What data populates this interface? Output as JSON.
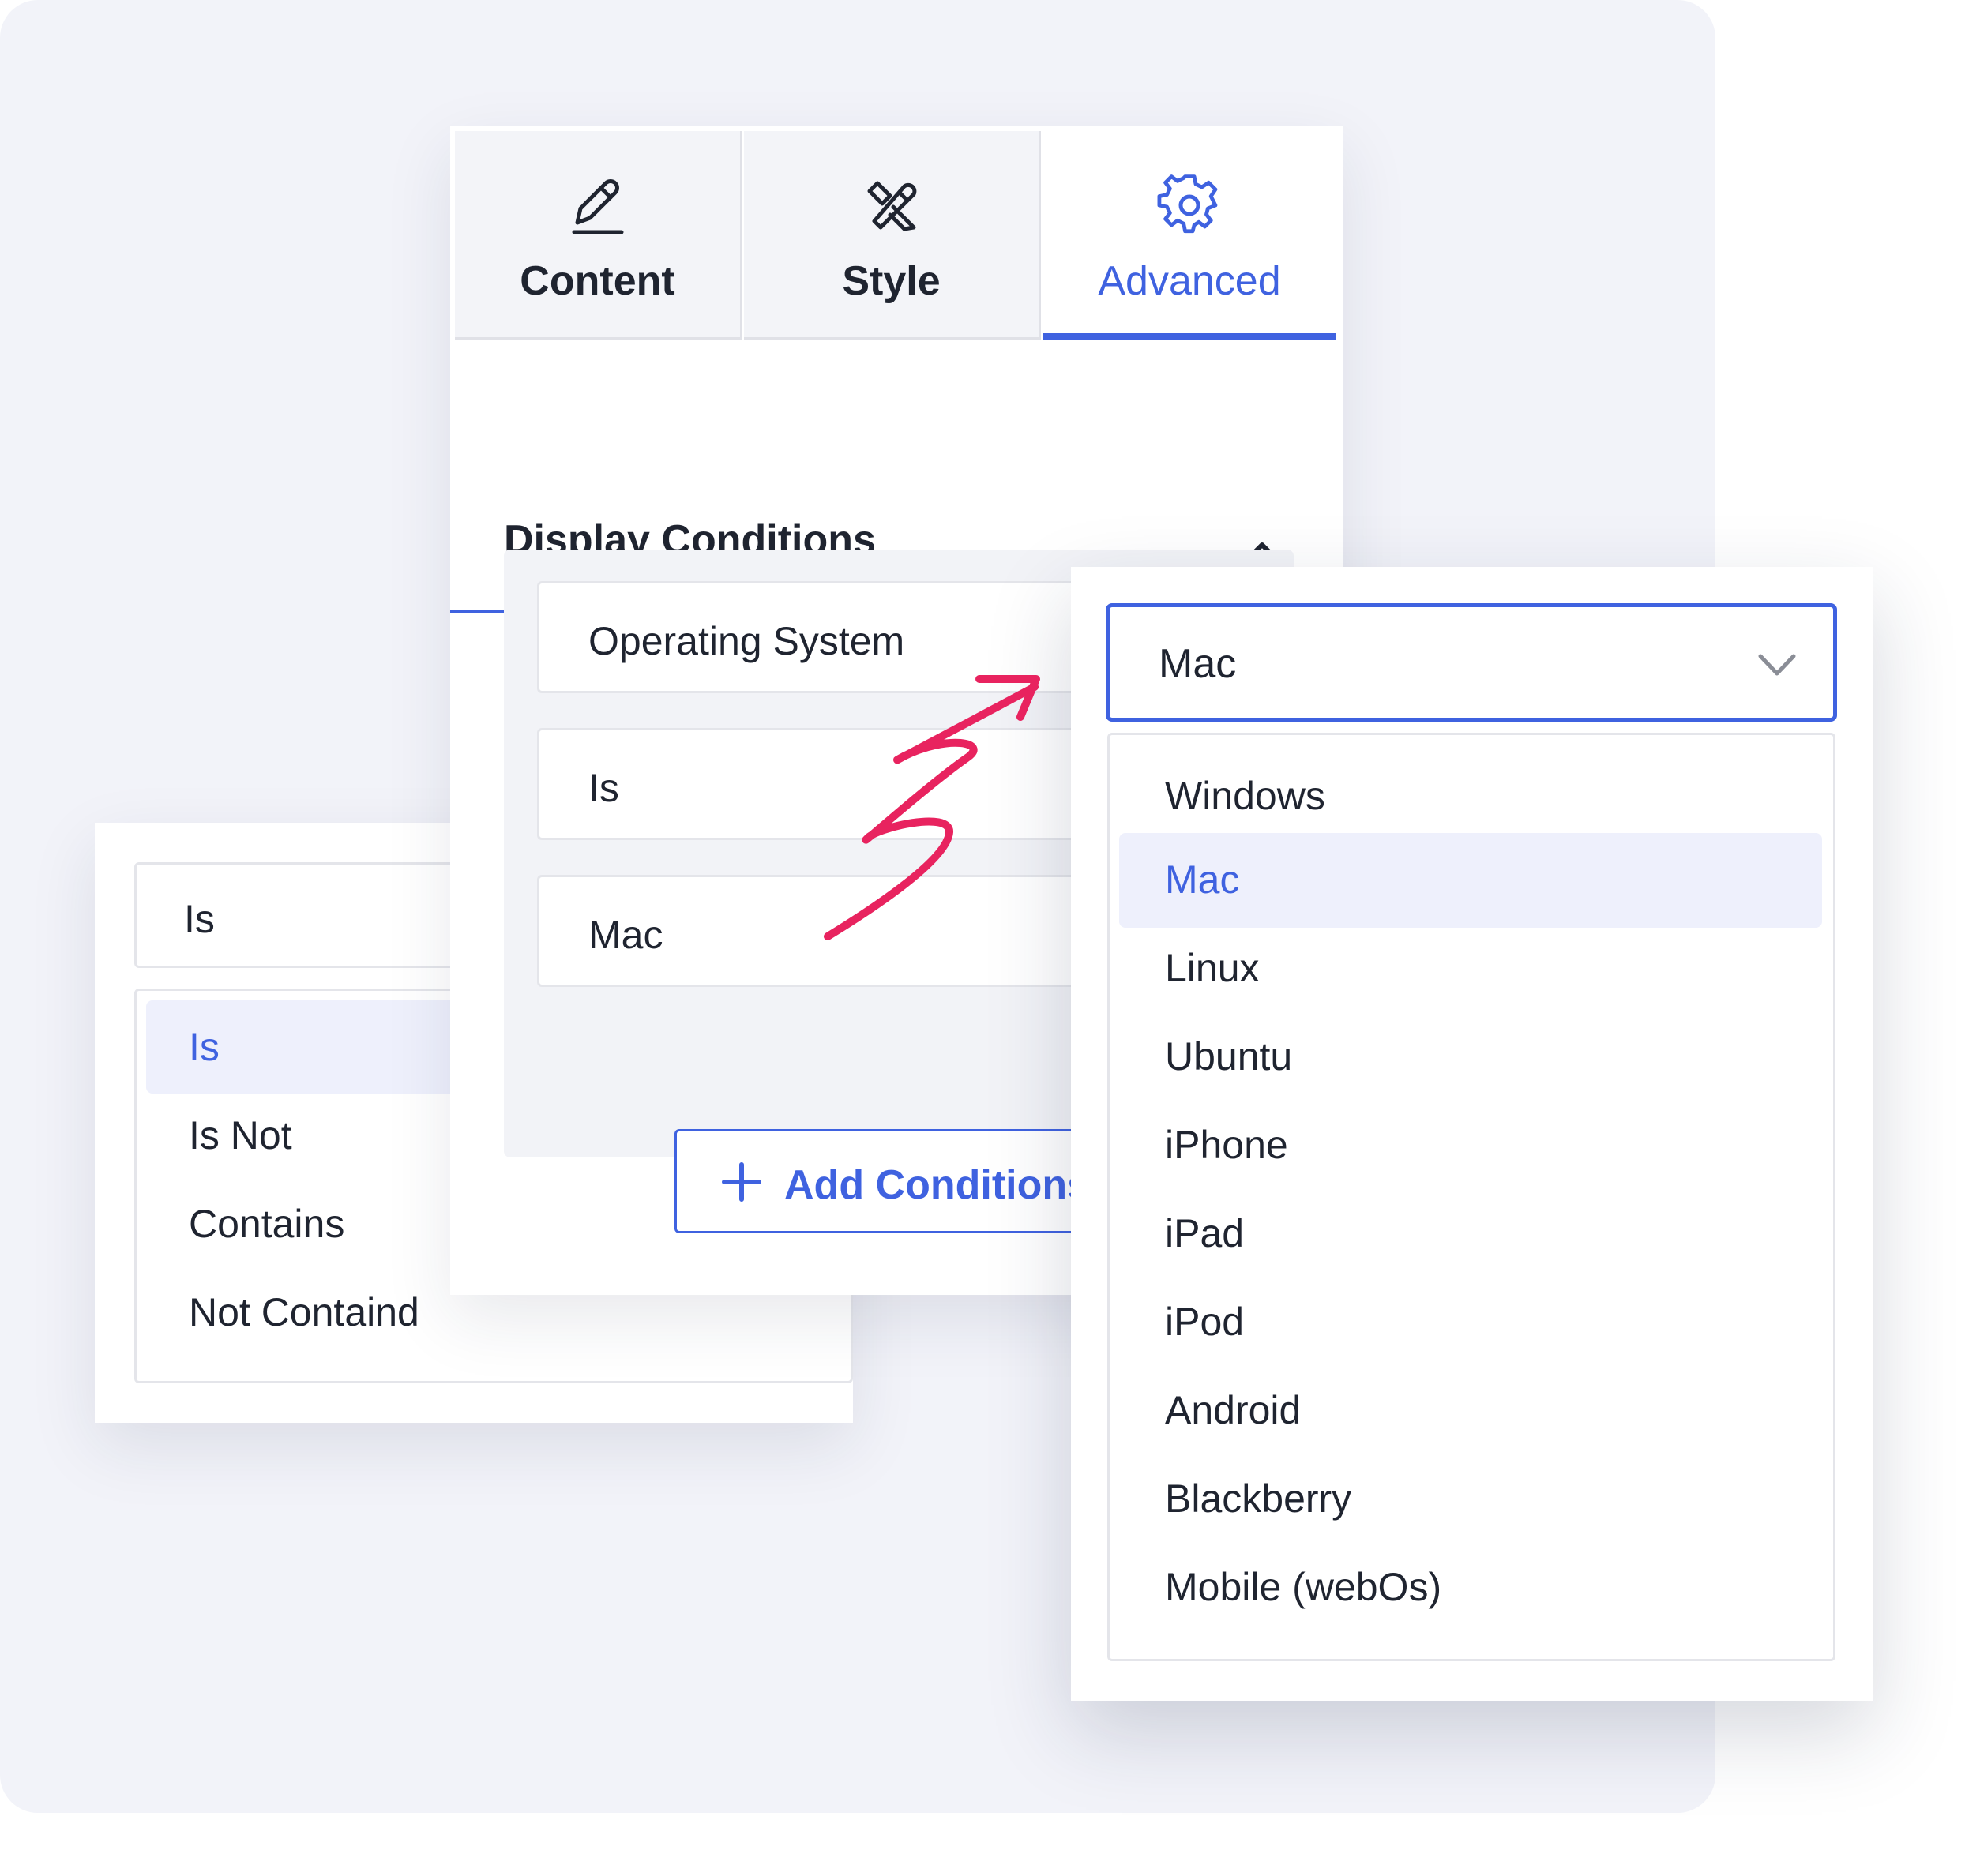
{
  "tabs": [
    {
      "label": "Content",
      "icon": "pencil-icon",
      "active": false
    },
    {
      "label": "Style",
      "icon": "style-brush-icon",
      "active": false
    },
    {
      "label": "Advanced",
      "icon": "gear-icon",
      "active": true
    }
  ],
  "section": {
    "title": "Display Conditions",
    "icon": "chevron-up-icon"
  },
  "conditions": {
    "type_value": "Operating System",
    "operator_value": "Is",
    "os_value": "Mac"
  },
  "add_button": {
    "label": "Add Conditions",
    "icon": "plus-icon"
  },
  "operator_dropdown": {
    "selected": "Is",
    "options": [
      "Is",
      "Is Not",
      "Contains",
      "Not Containd"
    ]
  },
  "os_dropdown": {
    "selected": "Mac",
    "options": [
      "Windows",
      "Mac",
      "Linux",
      "Ubuntu",
      "iPhone",
      "iPad",
      "iPod",
      "Android",
      "Blackberry",
      "Mobile (webOs)"
    ]
  },
  "colors": {
    "accent": "#3f62e0",
    "annotation": "#e8235f",
    "selected_bg": "#eef0fc",
    "backdrop": "#f2f3f9"
  }
}
